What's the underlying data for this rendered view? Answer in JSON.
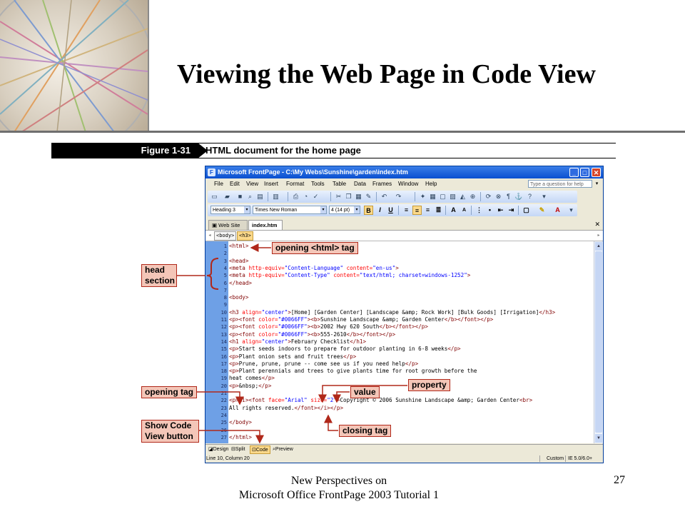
{
  "slide": {
    "title": "Viewing the Web Page in Code View",
    "footer_line1": "New Perspectives on",
    "footer_line2": "Microsoft Office FrontPage 2003 Tutorial 1",
    "page_number": "27"
  },
  "figure": {
    "label": "Figure 1-31",
    "caption": "HTML document for the home page"
  },
  "window": {
    "title": "Microsoft FrontPage - C:\\My Webs\\Sunshine\\garden\\index.htm",
    "menu": [
      "File",
      "Edit",
      "View",
      "Insert",
      "Format",
      "Tools",
      "Table",
      "Data",
      "Frames",
      "Window",
      "Help"
    ],
    "help_placeholder": "Type a question for help",
    "style_combo": "Heading 3",
    "font_combo": "Times New Roman",
    "size_combo": "4 (14 pt)",
    "bold": "B",
    "italic": "I",
    "underline": "U",
    "tabs": [
      "Web Site",
      "index.htm"
    ],
    "tag_chips": [
      "<body>",
      "<h3>"
    ],
    "view_buttons": [
      "Design",
      "Split",
      "Code",
      "Preview"
    ],
    "status_left": "Line 10, Column 20",
    "status_mode": "Custom",
    "status_browser": "IE 5.0/6.0+",
    "colors": {
      "title_bar": "#0a4fd0",
      "gutter": "#6ea0e6",
      "tag": "#800000",
      "attribute": "#ff0000",
      "value": "#0000ff",
      "callout_fill": "#f4c6b8",
      "callout_border": "#b0281a",
      "highlight": "#fbd98a"
    }
  },
  "code_lines": [
    {
      "n": "1",
      "segs": [
        [
          "tg",
          "<html>"
        ]
      ]
    },
    {
      "n": "2",
      "segs": []
    },
    {
      "n": "3",
      "segs": [
        [
          "tg",
          "<head>"
        ]
      ]
    },
    {
      "n": "4",
      "segs": [
        [
          "tg",
          "<meta "
        ],
        [
          "at",
          "http-equiv="
        ],
        [
          "va",
          "\"Content-Language\""
        ],
        [
          "at",
          " content="
        ],
        [
          "va",
          "\"en-us\""
        ],
        [
          "tg",
          ">"
        ]
      ]
    },
    {
      "n": "5",
      "segs": [
        [
          "tg",
          "<meta "
        ],
        [
          "at",
          "http-equiv="
        ],
        [
          "va",
          "\"Content-Type\""
        ],
        [
          "at",
          " content="
        ],
        [
          "va",
          "\"text/html; charset=windows-1252\""
        ],
        [
          "tg",
          ">"
        ]
      ]
    },
    {
      "n": "6",
      "segs": [
        [
          "tg",
          "</head>"
        ]
      ]
    },
    {
      "n": "7",
      "segs": []
    },
    {
      "n": "8",
      "segs": [
        [
          "tg",
          "<body>"
        ]
      ]
    },
    {
      "n": "9",
      "segs": []
    },
    {
      "n": "10",
      "segs": [
        [
          "tg",
          "<h3 "
        ],
        [
          "at",
          "align="
        ],
        [
          "va",
          "\"center\""
        ],
        [
          "tg",
          ">"
        ],
        [
          "pt",
          "[Home] [Garden Center] [Landscape &amp; Rock Work] [Bulk Goods] [Irrigation]"
        ],
        [
          "tg",
          "</h3>"
        ]
      ]
    },
    {
      "n": "11",
      "segs": [
        [
          "tg",
          "<p><font "
        ],
        [
          "at",
          "color="
        ],
        [
          "va",
          "\"#0066FF\""
        ],
        [
          "tg",
          "><b>"
        ],
        [
          "pt",
          "Sunshine Landscape &amp; Garden Center"
        ],
        [
          "tg",
          "</b></font></p>"
        ]
      ]
    },
    {
      "n": "12",
      "segs": [
        [
          "tg",
          "<p><font "
        ],
        [
          "at",
          "color="
        ],
        [
          "va",
          "\"#0066FF\""
        ],
        [
          "tg",
          "><b>"
        ],
        [
          "pt",
          "2002 Hwy 620 South"
        ],
        [
          "tg",
          "</b></font></p>"
        ]
      ]
    },
    {
      "n": "13",
      "segs": [
        [
          "tg",
          "<p><font "
        ],
        [
          "at",
          "color="
        ],
        [
          "va",
          "\"#0066FF\""
        ],
        [
          "tg",
          "><b>"
        ],
        [
          "pt",
          "555-2610"
        ],
        [
          "tg",
          "</b></font></p>"
        ]
      ]
    },
    {
      "n": "14",
      "segs": [
        [
          "tg",
          "<h1 "
        ],
        [
          "at",
          "align="
        ],
        [
          "va",
          "\"center\""
        ],
        [
          "tg",
          ">"
        ],
        [
          "pt",
          "February Checklist"
        ],
        [
          "tg",
          "</h1>"
        ]
      ]
    },
    {
      "n": "15",
      "segs": [
        [
          "tg",
          "<p>"
        ],
        [
          "pt",
          "Start seeds indoors to prepare for outdoor planting in 6-8 weeks"
        ],
        [
          "tg",
          "</p>"
        ]
      ]
    },
    {
      "n": "16",
      "segs": [
        [
          "tg",
          "<p>"
        ],
        [
          "pt",
          "Plant onion sets and fruit trees"
        ],
        [
          "tg",
          "</p>"
        ]
      ]
    },
    {
      "n": "17",
      "segs": [
        [
          "tg",
          "<p>"
        ],
        [
          "pt",
          "Prune, prune, prune -- come see us if you need help"
        ],
        [
          "tg",
          "</p>"
        ]
      ]
    },
    {
      "n": "18",
      "segs": [
        [
          "tg",
          "<p>"
        ],
        [
          "pt",
          "Plant perennials and trees to give plants time for root growth before the"
        ]
      ]
    },
    {
      "n": "19",
      "segs": [
        [
          "pt",
          "heat comes"
        ],
        [
          "tg",
          "</p>"
        ]
      ]
    },
    {
      "n": "20",
      "segs": [
        [
          "tg",
          "<p>"
        ],
        [
          "pt",
          "&nbsp;"
        ],
        [
          "tg",
          "</p>"
        ]
      ]
    },
    {
      "n": "21",
      "segs": []
    },
    {
      "n": "22",
      "segs": [
        [
          "tg",
          "<p><i><font "
        ],
        [
          "at",
          "face="
        ],
        [
          "va",
          "\"Arial\""
        ],
        [
          "at",
          " size="
        ],
        [
          "va",
          "\"2\""
        ],
        [
          "tg",
          ">"
        ],
        [
          "pt",
          "Copyright © 2006 Sunshine Landscape &amp; Garden Center"
        ],
        [
          "tg",
          "<br>"
        ]
      ]
    },
    {
      "n": "23",
      "segs": [
        [
          "pt",
          "All rights reserved."
        ],
        [
          "tg",
          "</font></i></p>"
        ]
      ]
    },
    {
      "n": "24",
      "segs": []
    },
    {
      "n": "25",
      "segs": [
        [
          "tg",
          "</body>"
        ]
      ]
    },
    {
      "n": "26",
      "segs": []
    },
    {
      "n": "27",
      "segs": [
        [
          "tg",
          "</html>"
        ]
      ]
    }
  ],
  "callouts": {
    "opening_html": "opening <html> tag",
    "head_line1": "head",
    "head_line2": "section",
    "opening_tag": "opening tag",
    "property": "property",
    "value": "value",
    "closing_tag": "closing tag",
    "show_code_line1": "Show Code",
    "show_code_line2": "View button"
  }
}
